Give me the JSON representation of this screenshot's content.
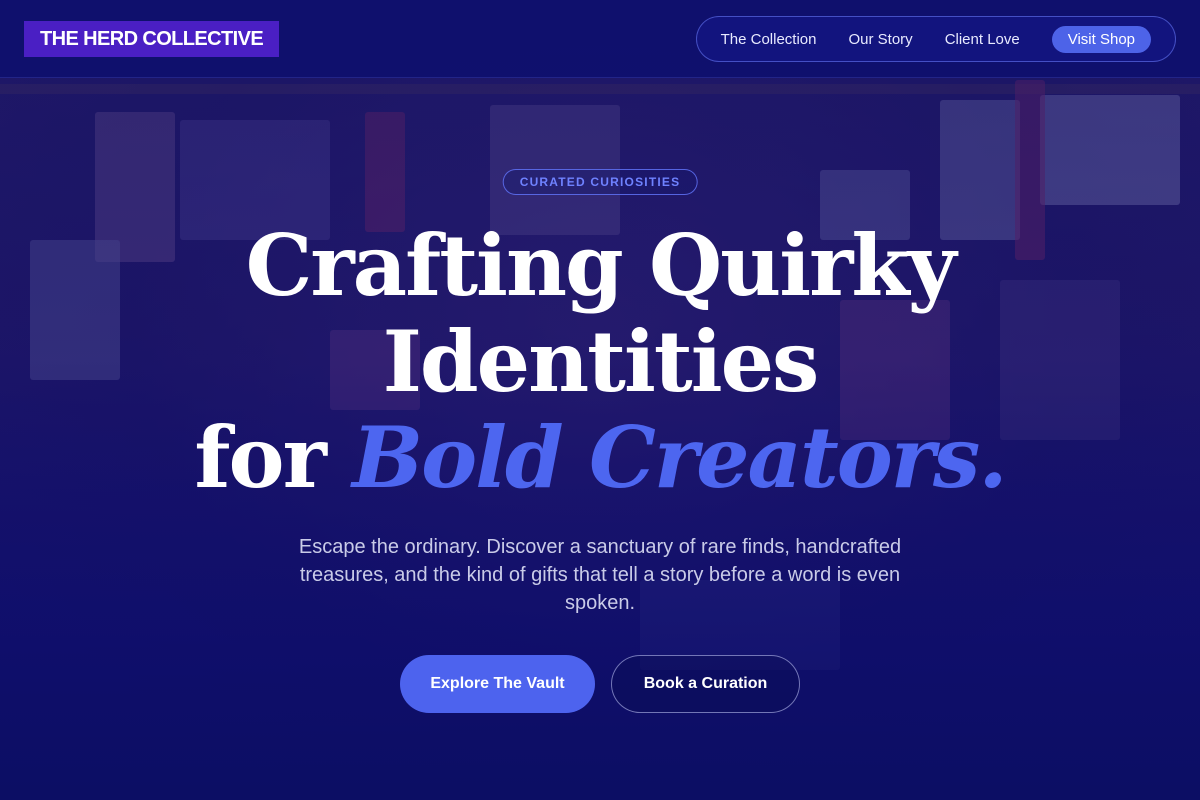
{
  "header": {
    "logo_text": "THE HERD COLLECTIVE",
    "nav": [
      {
        "label": "The Collection"
      },
      {
        "label": "Our Story"
      },
      {
        "label": "Client Love"
      }
    ],
    "shop_label": "Visit Shop"
  },
  "hero": {
    "eyebrow": "CURATED CURIOSITIES",
    "headline_line1": "Crafting Quirky",
    "headline_line2": "Identities",
    "headline_line3_prefix": "for ",
    "headline_line3_accent": "Bold Creators.",
    "subtext": "Escape the ordinary. Discover a sanctuary of rare finds, handcrafted treasures, and the kind of gifts that tell a story before a word is even spoken.",
    "primary_cta": "Explore The Vault",
    "secondary_cta": "Book a Curation"
  },
  "colors": {
    "background": "#0d0f5c",
    "logo_bg": "#4a1fc4",
    "accent": "#4d66f0",
    "eyebrow_text": "#6f82ff"
  }
}
